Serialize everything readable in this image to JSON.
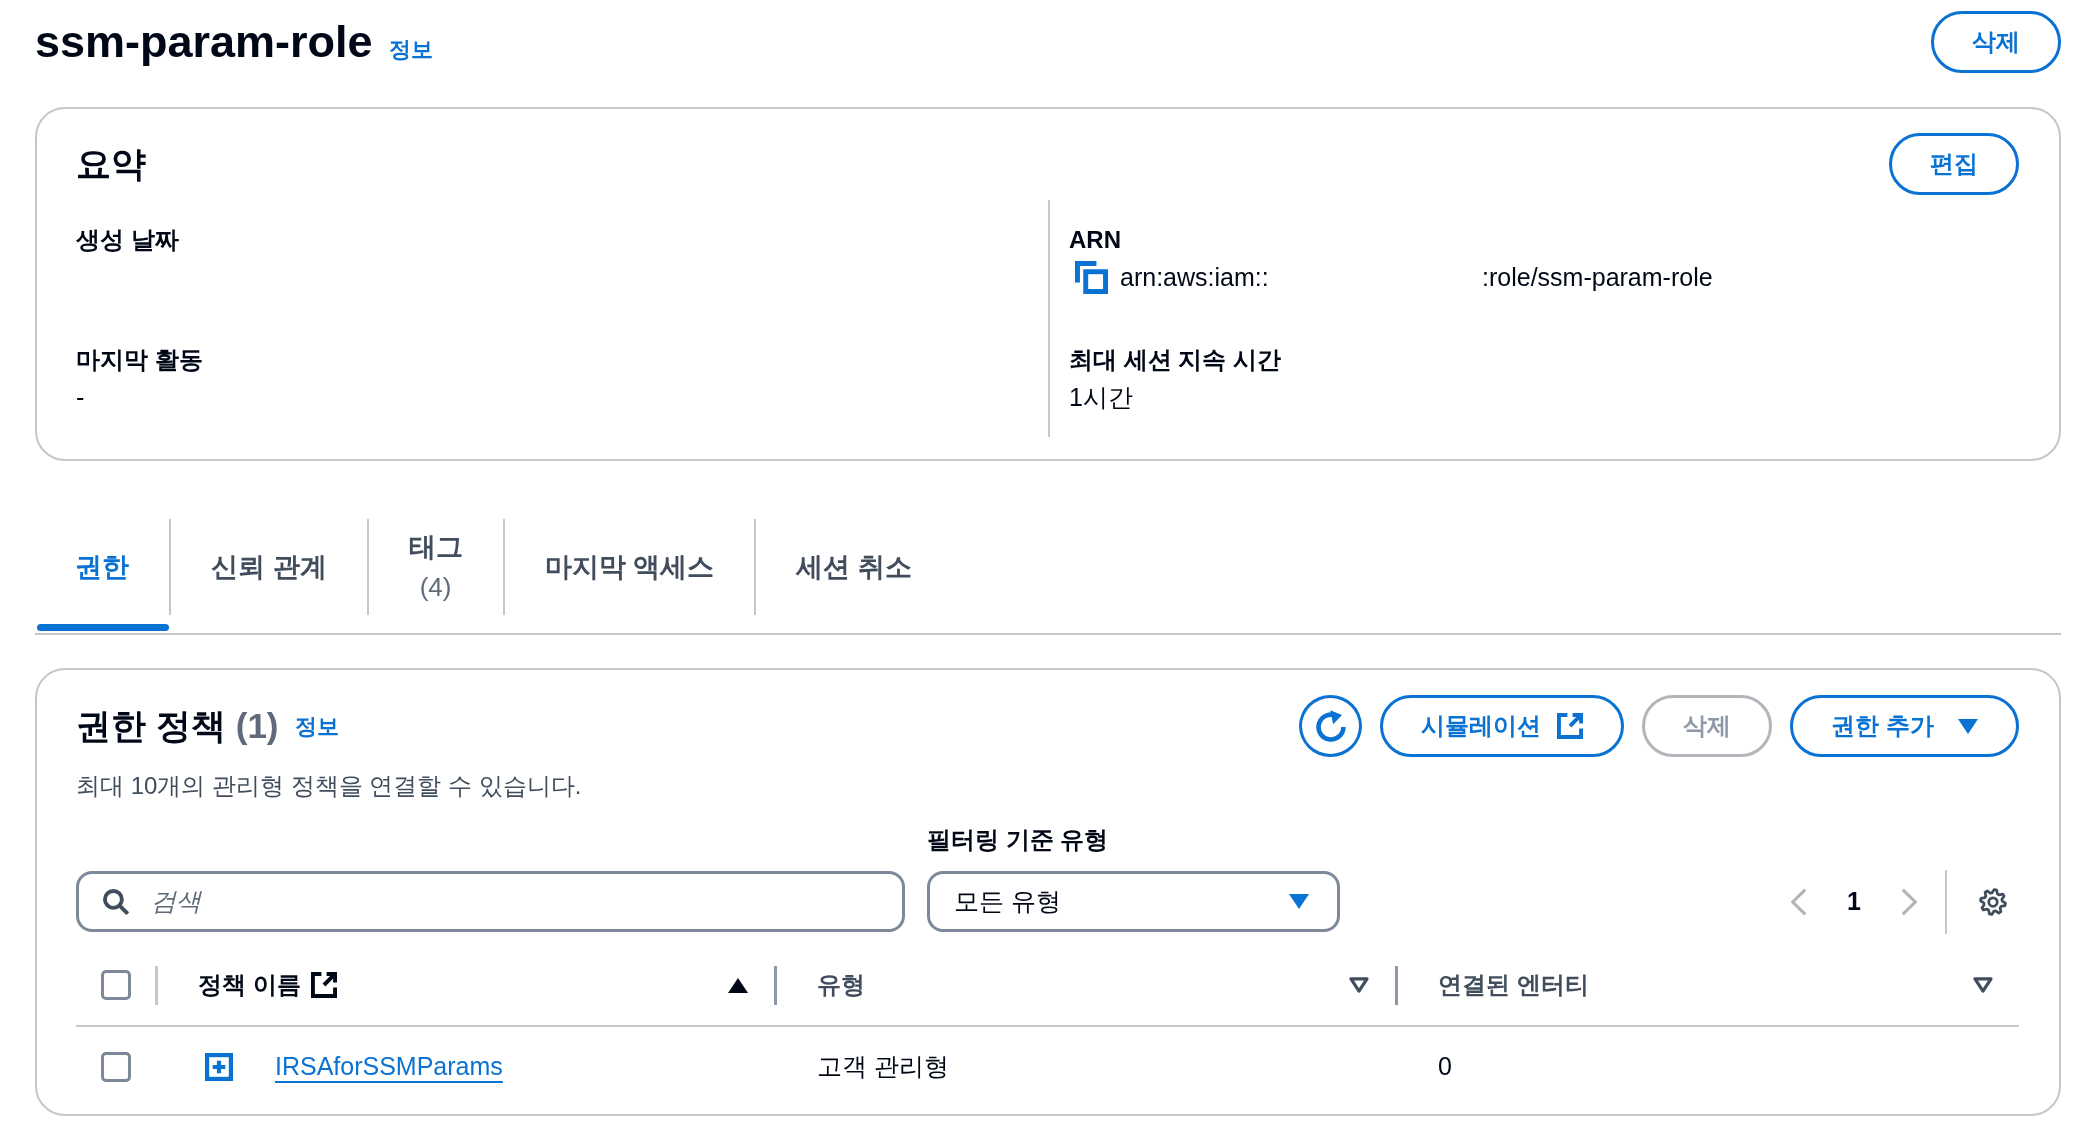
{
  "header": {
    "title": "ssm-param-role",
    "info_link": "정보",
    "actions": [
      {
        "label": "삭제",
        "disabled": false
      }
    ]
  },
  "summary": {
    "title": "요약",
    "actions": [
      {
        "label": "편집",
        "disabled": false
      }
    ],
    "columns": [
      {
        "fields": [
          {
            "kind": "text",
            "label": "생성 날짜"
          },
          {
            "kind": "text",
            "label": "마지막 활동",
            "value": "-"
          }
        ]
      },
      {
        "fields": [
          {
            "kind": "copyable",
            "label": "ARN",
            "value_parts": [
              "arn:aws:iam::",
              ":role/ssm-param-role"
            ]
          },
          {
            "kind": "text",
            "label": "최대 세션 지속 시간",
            "value": "1시간"
          }
        ]
      }
    ]
  },
  "tabs": [
    {
      "label": "권한",
      "selected": true
    },
    {
      "label": "신뢰 관계",
      "selected": false
    },
    {
      "label": "태그",
      "count": "(4)",
      "selected": false
    },
    {
      "label": "마지막 액세스",
      "selected": false
    },
    {
      "label": "세션 취소",
      "selected": false
    }
  ],
  "permissions": {
    "title": "권한 정책",
    "count": "(1)",
    "info_link": "정보",
    "description": "최대 10개의 관리형 정책을 연결할 수 있습니다.",
    "actions": [
      {
        "kind": "refresh",
        "disabled": false
      },
      {
        "kind": "external",
        "label": "시뮬레이션",
        "disabled": false
      },
      {
        "kind": "plain",
        "label": "삭제",
        "disabled": true
      },
      {
        "kind": "dropdown",
        "label": "권한 추가",
        "disabled": false
      }
    ],
    "search": {
      "placeholder": "검색"
    },
    "filter": {
      "label": "필터링 기준 유형",
      "value": "모든 유형"
    },
    "pagination": {
      "previous": {
        "disabled": true
      },
      "pages": [
        {
          "label": "1",
          "selected": true
        }
      ],
      "next": {
        "disabled": true
      }
    },
    "table": {
      "select_all": {
        "checked": false
      },
      "columns": [
        {
          "label": "정책 이름",
          "external_link": true,
          "sorted": true
        },
        {
          "label": "유형",
          "external_link": false,
          "sorted": false
        },
        {
          "label": "연결된 엔터티",
          "external_link": false,
          "sorted": false
        }
      ],
      "rows": [
        {
          "selected": false,
          "expanded": false,
          "cells": [
            {
              "kind": "link",
              "text": "IRSAforSSMParams"
            },
            {
              "kind": "text",
              "text": "고객 관리형"
            },
            {
              "kind": "text",
              "text": "0"
            }
          ]
        }
      ]
    }
  }
}
